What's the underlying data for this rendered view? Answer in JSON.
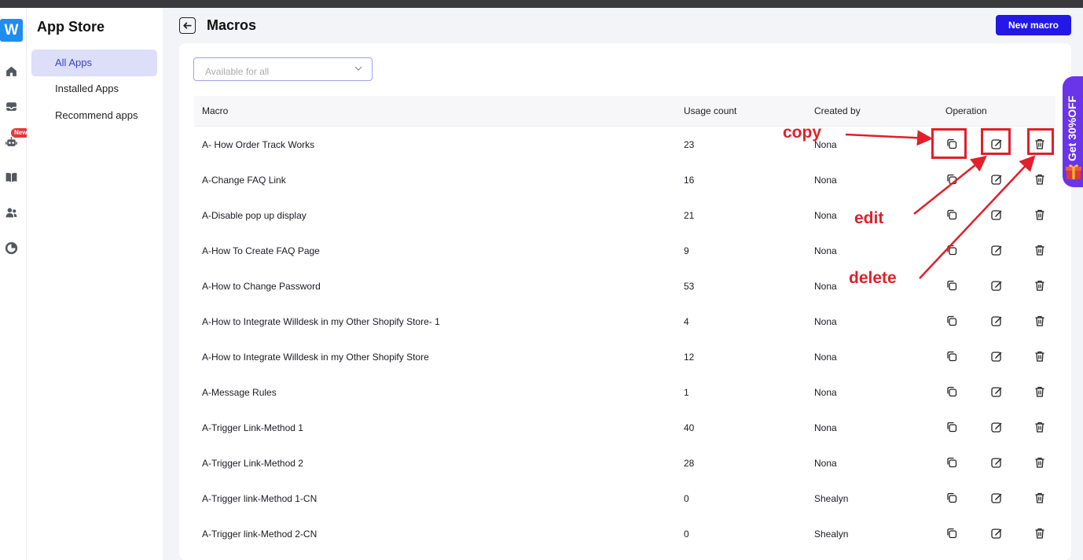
{
  "app": {
    "logo_letter": "W",
    "title": "App Store",
    "new_badge": "New"
  },
  "rail_icons": [
    "home-icon",
    "inbox-icon",
    "robot-icon",
    "book-icon",
    "users-icon",
    "chart-icon"
  ],
  "subnav": {
    "items": [
      {
        "label": "All Apps",
        "active": true
      },
      {
        "label": "Installed Apps",
        "active": false
      },
      {
        "label": "Recommend apps",
        "active": false
      }
    ]
  },
  "header": {
    "title": "Macros",
    "new_button": "New macro"
  },
  "filter": {
    "placeholder": "Available for all"
  },
  "table": {
    "headers": {
      "macro": "Macro",
      "usage": "Usage count",
      "created_by": "Created by",
      "operation": "Operation"
    },
    "rows": [
      {
        "macro": "A- How Order Track Works",
        "usage": "23",
        "created_by": "Nona"
      },
      {
        "macro": "A-Change FAQ Link",
        "usage": "16",
        "created_by": "Nona"
      },
      {
        "macro": "A-Disable pop up display",
        "usage": "21",
        "created_by": "Nona"
      },
      {
        "macro": "A-How To Create FAQ Page",
        "usage": "9",
        "created_by": "Nona"
      },
      {
        "macro": "A-How to Change Password",
        "usage": "53",
        "created_by": "Nona"
      },
      {
        "macro": "A-How to Integrate Willdesk in my Other Shopify Store- 1",
        "usage": "4",
        "created_by": "Nona"
      },
      {
        "macro": "A-How to Integrate Willdesk in my Other Shopify Store",
        "usage": "12",
        "created_by": "Nona"
      },
      {
        "macro": "A-Message Rules",
        "usage": "1",
        "created_by": "Nona"
      },
      {
        "macro": "A-Trigger Link-Method 1",
        "usage": "40",
        "created_by": "Nona"
      },
      {
        "macro": "A-Trigger Link-Method 2",
        "usage": "28",
        "created_by": "Nona"
      },
      {
        "macro": "A-Trigger link-Method 1-CN",
        "usage": "0",
        "created_by": "Shealyn"
      },
      {
        "macro": "A-Trigger link-Method 2-CN",
        "usage": "0",
        "created_by": "Shealyn"
      }
    ]
  },
  "promo": {
    "text": "Get 30%OFF"
  },
  "annotations": {
    "copy": "copy",
    "edit": "edit",
    "delete": "delete"
  },
  "colors": {
    "accent": "#2418e6",
    "active_nav_bg": "#dcdff7",
    "annotation": "#e0202a",
    "promo": "#6a35e8",
    "logo": "#1f8cf0"
  }
}
